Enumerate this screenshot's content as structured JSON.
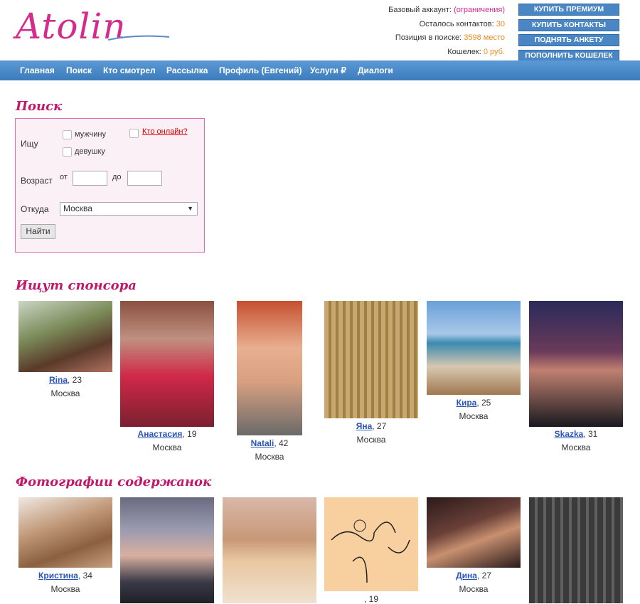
{
  "logo": "Atolin",
  "account": {
    "rows": [
      {
        "label": "Базовый аккаунт:",
        "value": "(ограничения)",
        "tone": "pink"
      },
      {
        "label": "Осталось контактов:",
        "value": "30",
        "tone": "orange"
      },
      {
        "label": "Позиция в поиске:",
        "value": "3598 место",
        "tone": "orange"
      },
      {
        "label": "Кошелек:",
        "value": "0 руб.",
        "tone": "orange"
      }
    ],
    "buttons": [
      "КУПИТЬ ПРЕМИУМ",
      "КУПИТЬ КОНТАКТЫ",
      "ПОДНЯТЬ АНКЕТУ",
      "ПОПОЛНИТЬ КОШЕЛЕК"
    ]
  },
  "nav": [
    "Главная",
    "Поиск",
    "Кто смотрел",
    "Рассылка",
    "Профиль (Евгений)",
    "Услуги ₽",
    "Диалоги"
  ],
  "search": {
    "title": "Поиск",
    "seek_label": "Ищу",
    "opt_male": "мужчину",
    "opt_female": "девушку",
    "online_link": "Кто онлайн?",
    "age_label": "Возраст",
    "age_from": "от",
    "age_to": "до",
    "from_label": "Откуда",
    "city_value": "Москва",
    "find_button": "Найти"
  },
  "sponsor_section": {
    "title": "Ищут спонсора",
    "profiles": [
      {
        "name": "Rina",
        "age": ", 23",
        "city": "Москва"
      },
      {
        "name": "Анастасия",
        "age": ", 19",
        "city": "Москва"
      },
      {
        "name": "Natali",
        "age": ", 42",
        "city": "Москва"
      },
      {
        "name": "Яна",
        "age": ", 27",
        "city": "Москва"
      },
      {
        "name": "Кира",
        "age": ", 25",
        "city": "Москва"
      },
      {
        "name": "Skazka",
        "age": ", 31",
        "city": "Москва"
      }
    ]
  },
  "photos_section": {
    "title": "Фотографии содержанок",
    "profiles": [
      {
        "name": "Кристина",
        "age": ", 34",
        "city": "Москва"
      },
      {
        "name": "",
        "age": "",
        "city": ""
      },
      {
        "name": "",
        "age": "",
        "city": ""
      },
      {
        "name": "",
        "age": ", 19",
        "city": ""
      },
      {
        "name": "Дина",
        "age": ", 27",
        "city": "Москва"
      },
      {
        "name": "",
        "age": "",
        "city": ""
      }
    ]
  },
  "colors": {
    "brand": "#d42b8c",
    "nav": "#3c7cbd",
    "link": "#2a55b8",
    "accent": "#f08a24"
  }
}
